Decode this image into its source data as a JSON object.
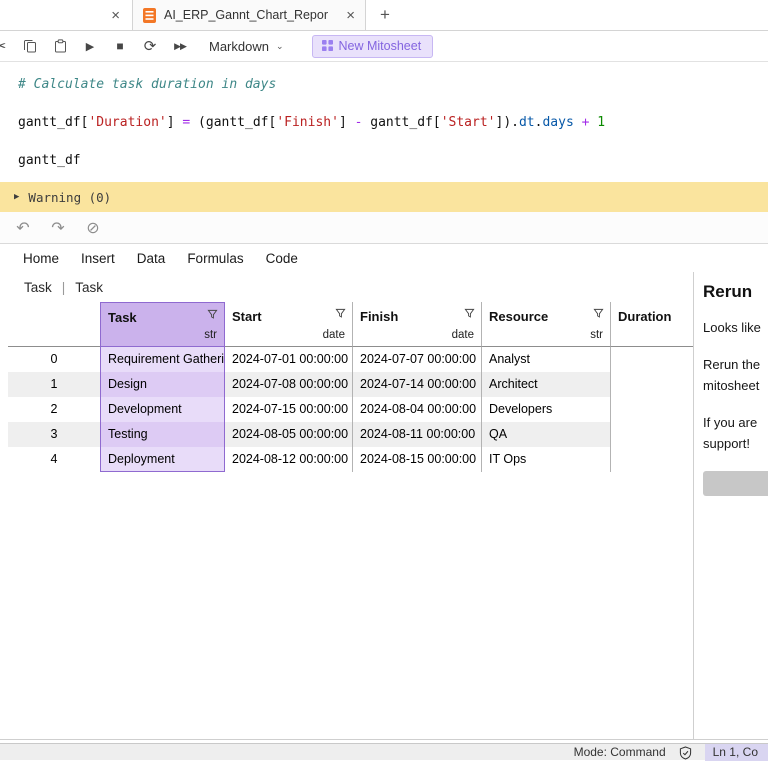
{
  "tabbar": {
    "prev_tab_close": "×",
    "tab_title": "AI_ERP_Gannt_Chart_Repor",
    "tab_close": "×",
    "new_tab": "+"
  },
  "toolbar": {
    "cell_type": "Markdown",
    "caret": "⌄",
    "new_mitosheet": "New Mitosheet"
  },
  "icons": {
    "cut": "✂",
    "run": "▶",
    "stop": "■",
    "restart": "⟳",
    "run_all": "▶▶",
    "undo": "↶",
    "redo": "↷",
    "clear": "⊘"
  },
  "code": {
    "comment": "# Calculate task duration in days",
    "l2": {
      "p1": "gantt_df[",
      "s1": "'Duration'",
      "p2": "] ",
      "o1": "=",
      "p3": " (gantt_df[",
      "s2": "'Finish'",
      "p4": "] ",
      "o2": "-",
      "p5": " gantt_df[",
      "s3": "'Start'",
      "p6": "]).",
      "pr1": "dt",
      "p7": ".",
      "pr2": "days",
      "p8": " ",
      "o3": "+",
      "p9": " ",
      "n1": "1"
    },
    "l3": "gantt_df"
  },
  "warning": {
    "arrow": "▶",
    "label": "Warning (0)"
  },
  "mito": {
    "menu": [
      "Home",
      "Insert",
      "Data",
      "Formulas",
      "Code"
    ],
    "sheet_tab_a": "Task",
    "sheet_tab_sep": "|",
    "sheet_tab_b": "Task",
    "columns": [
      {
        "name": "Task",
        "type": "str"
      },
      {
        "name": "Start",
        "type": "date"
      },
      {
        "name": "Finish",
        "type": "date"
      },
      {
        "name": "Resource",
        "type": "str"
      },
      {
        "name": "Duration",
        "type": ""
      }
    ],
    "rows": [
      {
        "idx": "0",
        "task": "Requirement Gathering",
        "start": "2024-07-01 00:00:00",
        "finish": "2024-07-07 00:00:00",
        "resource": "Analyst",
        "duration": ""
      },
      {
        "idx": "1",
        "task": "Design",
        "start": "2024-07-08 00:00:00",
        "finish": "2024-07-14 00:00:00",
        "resource": "Architect",
        "duration": ""
      },
      {
        "idx": "2",
        "task": "Development",
        "start": "2024-07-15 00:00:00",
        "finish": "2024-08-04 00:00:00",
        "resource": "Developers",
        "duration": ""
      },
      {
        "idx": "3",
        "task": "Testing",
        "start": "2024-08-05 00:00:00",
        "finish": "2024-08-11 00:00:00",
        "resource": "QA",
        "duration": ""
      },
      {
        "idx": "4",
        "task": "Deployment",
        "start": "2024-08-12 00:00:00",
        "finish": "2024-08-15 00:00:00",
        "resource": "IT Ops",
        "duration": ""
      }
    ],
    "panel": {
      "title": "Rerun",
      "line1": "Looks like",
      "line2": "Rerun the",
      "line3": "mitosheet",
      "line4": "If you are",
      "line5": "support!"
    }
  },
  "statusbar": {
    "mode": "Mode: Command",
    "position": "Ln 1, Co"
  }
}
